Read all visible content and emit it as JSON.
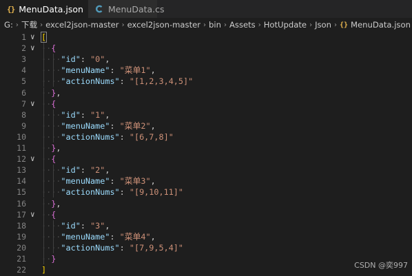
{
  "tabs": [
    {
      "label": "MenuData.json",
      "icon": "json-file-icon",
      "active": true
    },
    {
      "label": "MenuData.cs",
      "icon": "csharp-file-icon",
      "active": false
    }
  ],
  "breadcrumb": [
    "G:",
    "下载",
    "excel2json-master",
    "excel2json-master",
    "bin",
    "Assets",
    "HotUpdate",
    "Json",
    "MenuData.json",
    "..."
  ],
  "editor": {
    "lines": [
      {
        "n": "1",
        "fold": true
      },
      {
        "n": "2",
        "fold": true
      },
      {
        "n": "3",
        "key": "\"id\"",
        "value": "\"0\""
      },
      {
        "n": "4",
        "key": "\"menuName\"",
        "value": "\"菜单1\""
      },
      {
        "n": "5",
        "key": "\"actionNums\"",
        "value": "\"[1,2,3,4,5]\""
      },
      {
        "n": "6"
      },
      {
        "n": "7",
        "fold": true
      },
      {
        "n": "8",
        "key": "\"id\"",
        "value": "\"1\""
      },
      {
        "n": "9",
        "key": "\"menuName\"",
        "value": "\"菜单2\""
      },
      {
        "n": "10",
        "key": "\"actionNums\"",
        "value": "\"[6,7,8]\""
      },
      {
        "n": "11"
      },
      {
        "n": "12",
        "fold": true
      },
      {
        "n": "13",
        "key": "\"id\"",
        "value": "\"2\""
      },
      {
        "n": "14",
        "key": "\"menuName\"",
        "value": "\"菜单3\""
      },
      {
        "n": "15",
        "key": "\"actionNums\"",
        "value": "\"[9,10,11]\""
      },
      {
        "n": "16"
      },
      {
        "n": "17",
        "fold": true
      },
      {
        "n": "18",
        "key": "\"id\"",
        "value": "\"3\""
      },
      {
        "n": "19",
        "key": "\"menuName\"",
        "value": "\"菜单4\""
      },
      {
        "n": "20",
        "key": "\"actionNums\"",
        "value": "\"[7,9,5,4]\""
      },
      {
        "n": "21"
      },
      {
        "n": "22"
      }
    ]
  },
  "watermark": "CSDN @奕997",
  "colors": {
    "background": "#1e1e1e",
    "key": "#9cdcfe",
    "string": "#ce9178",
    "bracket_outer": "#ffd700",
    "bracket_inner": "#da70d6"
  }
}
